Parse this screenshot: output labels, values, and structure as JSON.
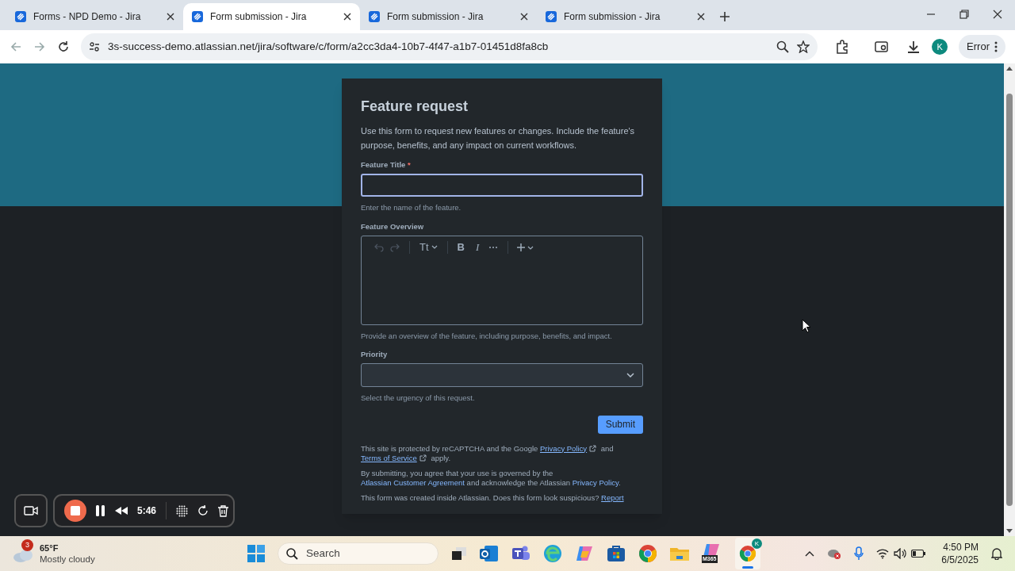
{
  "browser": {
    "tabs": [
      {
        "title": "Forms - NPD Demo - Jira",
        "selected": false
      },
      {
        "title": "Form submission - Jira",
        "selected": true
      },
      {
        "title": "Form submission - Jira",
        "selected": false
      },
      {
        "title": "Form submission - Jira",
        "selected": false
      }
    ],
    "url": "3s-success-demo.atlassian.net/jira/software/c/form/a2cc3da4-10b7-4f47-a1b7-01451d8fa8cb",
    "profile": "K",
    "status": "Error"
  },
  "form": {
    "title": "Feature request",
    "description": "Use this form to request new features or changes. Include the feature's purpose, benefits, and any impact on current workflows.",
    "fields": [
      {
        "kind": "text",
        "label": "Feature Title",
        "required_mark": "*",
        "focused": true,
        "hint": "Enter the name of the feature."
      },
      {
        "kind": "rich",
        "label": "Feature Overview",
        "focused": false,
        "toolbar": {
          "text_style": "Tt",
          "bold": "B",
          "italic": "I"
        },
        "hint": "Provide an overview of the feature, including purpose, benefits, and impact."
      },
      {
        "kind": "select",
        "label": "Priority",
        "focused": false,
        "hint": "Select the urgency of this request."
      }
    ],
    "submit": "Submit",
    "legal": [
      [
        {
          "kind": "text",
          "text": "This site is protected by reCAPTCHA and the Google "
        },
        {
          "kind": "external_link",
          "text": "Privacy Policy"
        },
        {
          "kind": "text",
          "text": " and "
        },
        {
          "kind": "external_link",
          "text": "Terms of Service"
        },
        {
          "kind": "text",
          "text": " apply."
        }
      ],
      [
        {
          "kind": "text",
          "text": "By submitting, you agree that your use is governed by the "
        },
        {
          "kind": "link",
          "text": "Atlassian Customer Agreement"
        },
        {
          "kind": "text",
          "text": " and acknowledge the Atlassian "
        },
        {
          "kind": "link",
          "text": "Privacy Policy"
        },
        {
          "kind": "text",
          "text": "."
        }
      ],
      [
        {
          "kind": "text",
          "text": "This form was created inside Atlassian. Does this form look suspicious? "
        },
        {
          "kind": "underlined_link",
          "text": "Report"
        }
      ]
    ]
  },
  "recorder": {
    "time": "5:46"
  },
  "taskbar": {
    "weather": {
      "badge": "3",
      "temperature": "65°F",
      "condition": "Mostly cloudy"
    },
    "search_placeholder": "Search",
    "m365_label": "M365",
    "chrome_profile": "K",
    "time": "4:50 PM",
    "date": "6/5/2025"
  }
}
